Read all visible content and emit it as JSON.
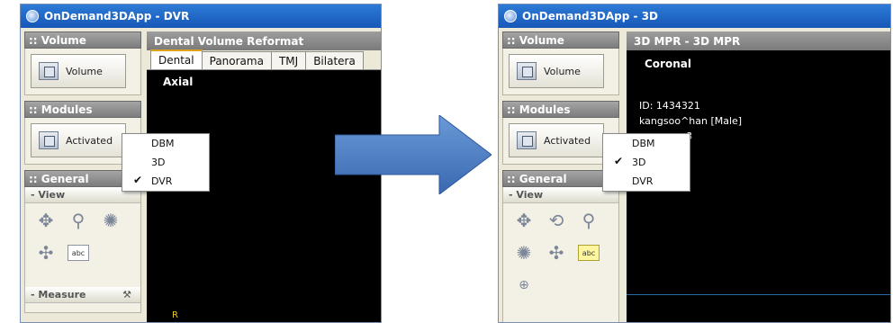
{
  "arrow_color": "#4a7ec6",
  "left_window": {
    "title": "OnDemand3DApp - DVR",
    "sidebar": {
      "volume_group": {
        "header": ":: Volume",
        "button_label": "Volume"
      },
      "modules_group": {
        "header": ":: Modules",
        "button_label": "Activated"
      },
      "general_group": {
        "header": ":: General",
        "view_header": "- View",
        "measure_header": "- Measure"
      }
    },
    "menu": {
      "items": [
        {
          "label": "DBM",
          "checked": false
        },
        {
          "label": "3D",
          "checked": false
        },
        {
          "label": "DVR",
          "checked": true
        }
      ]
    },
    "panel": {
      "header": "Dental Volume Reformat",
      "tabs": [
        "Dental",
        "Panorama",
        "TMJ",
        "Bilatera"
      ],
      "active_tab": "Dental",
      "view_label": "Axial",
      "marker": "R"
    }
  },
  "right_window": {
    "title": "OnDemand3DApp - 3D",
    "sidebar": {
      "volume_group": {
        "header": ":: Volume",
        "button_label": "Volume"
      },
      "modules_group": {
        "header": ":: Modules",
        "button_label": "Activated"
      },
      "general_group": {
        "header": ":: General",
        "view_header": "- View"
      }
    },
    "menu": {
      "items": [
        {
          "label": "DBM",
          "checked": false
        },
        {
          "label": "3D",
          "checked": true
        },
        {
          "label": "DVR",
          "checked": false
        }
      ]
    },
    "panel": {
      "header": "3D MPR - 3D MPR",
      "view_label": "Coronal",
      "patient_id": "ID: 1434321",
      "patient_name": "kangsoo^han [Male]",
      "partial_text": "8"
    }
  }
}
